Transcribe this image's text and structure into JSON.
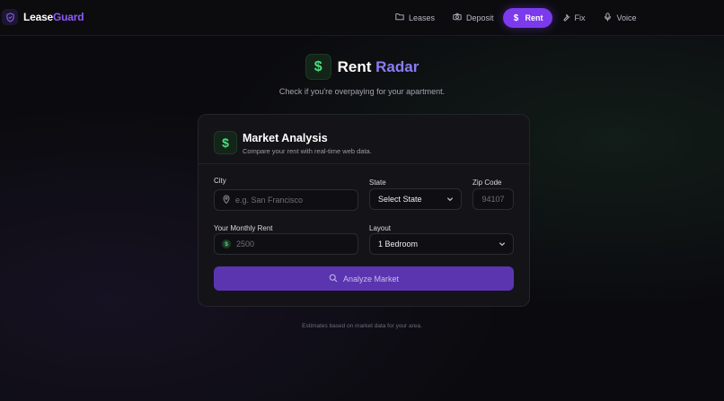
{
  "brand": {
    "name_part1": "Lease",
    "name_part2": "Guard",
    "logo_icon": "shield-icon",
    "accent_color": "#8b5cf6"
  },
  "nav": {
    "items": [
      {
        "label": "Leases",
        "icon": "folder-icon",
        "active": false
      },
      {
        "label": "Deposit",
        "icon": "camera-icon",
        "active": false
      },
      {
        "label": "Rent",
        "icon": "dollar-icon",
        "active": true
      },
      {
        "label": "Fix",
        "icon": "wrench-icon",
        "active": false
      },
      {
        "label": "Voice",
        "icon": "microphone-icon",
        "active": false
      }
    ],
    "active_color": "#7c3aed"
  },
  "hero": {
    "icon": "dollar-icon",
    "title_part1": "Rent",
    "title_part2": "Radar",
    "subtitle": "Check if you're overpaying for your apartment."
  },
  "card": {
    "icon": "dollar-icon",
    "title": "Market Analysis",
    "subtitle": "Compare your rent with real-time web data."
  },
  "form": {
    "city": {
      "label": "City",
      "placeholder": "e.g. San Francisco",
      "value": ""
    },
    "state": {
      "label": "State",
      "value": "Select State"
    },
    "zip": {
      "label": "Zip Code",
      "placeholder": "94107",
      "value": ""
    },
    "rent": {
      "label": "Your Monthly Rent",
      "placeholder": "2500",
      "value": ""
    },
    "layout": {
      "label": "Layout",
      "value": "1 Bedroom"
    },
    "submit_label": "Analyze Market"
  },
  "footnote": "Estimates based on market data for your area."
}
